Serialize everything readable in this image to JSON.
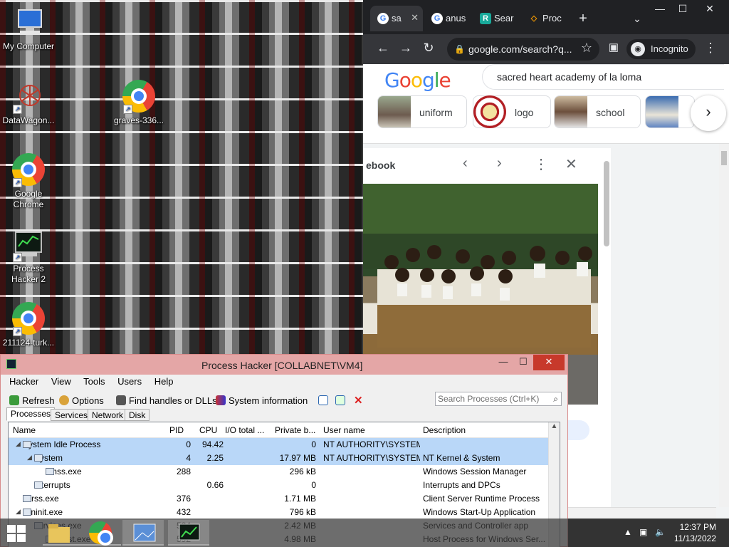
{
  "desktop": {
    "icons": [
      {
        "label_lines": [
          "My Computer"
        ],
        "icon": "computer-icon"
      },
      {
        "label_lines": [
          "DataWagon..."
        ],
        "icon": "datawagon-icon"
      },
      {
        "label_lines": [
          "graves-336..."
        ],
        "icon": "chrome-icon"
      },
      {
        "label_lines": [
          "Google",
          "Chrome"
        ],
        "icon": "chrome-icon"
      },
      {
        "label_lines": [
          "Process",
          "Hacker 2"
        ],
        "icon": "process-hacker-icon"
      },
      {
        "label_lines": [
          "211124-turk..."
        ],
        "icon": "chrome-icon"
      }
    ]
  },
  "browser": {
    "tabs": [
      {
        "label": "sa",
        "fav": "G",
        "fav_color": "#ffffff",
        "active": true
      },
      {
        "label": "anus",
        "fav": "G",
        "fav_color": "#ffffff"
      },
      {
        "label": "Sear",
        "fav": "R",
        "fav_color": "#18a99a"
      },
      {
        "label": "Proc",
        "fav": "◇",
        "fav_color": "#f29900"
      }
    ],
    "new_tab": "+",
    "tab_menu": "⌄",
    "window_controls": {
      "minimize": "—",
      "maximize": "☐",
      "close": "✕"
    },
    "url": "google.com/search?q...",
    "incognito_label": "Incognito",
    "search_query": "sacred heart academy of la loma",
    "logo": "Google",
    "chips": [
      {
        "label": "uniform"
      },
      {
        "label": "logo"
      },
      {
        "label": "school"
      }
    ],
    "panel": {
      "title": "ebook"
    }
  },
  "process_hacker": {
    "title": "Process Hacker [COLLABNET\\VM4]",
    "menu": [
      "Hacker",
      "View",
      "Tools",
      "Users",
      "Help"
    ],
    "toolbar": {
      "refresh": "Refresh",
      "options": "Options",
      "find_handles": "Find handles or DLLs",
      "system_info": "System information"
    },
    "search_placeholder": "Search Processes (Ctrl+K)",
    "tabs": [
      "Processes",
      "Services",
      "Network",
      "Disk"
    ],
    "columns": [
      "Name",
      "PID",
      "CPU",
      "I/O total ...",
      "Private b...",
      "User name",
      "Description"
    ],
    "rows": [
      {
        "name": "System Idle Process",
        "pid": "0",
        "cpu": "94.42",
        "io": "",
        "priv": "0",
        "user": "NT AUTHORITY\\SYSTEM",
        "desc": "",
        "indent": 1,
        "expand": "◢",
        "highlight": "sel"
      },
      {
        "name": "System",
        "pid": "4",
        "cpu": "2.25",
        "io": "",
        "priv": "17.97 MB",
        "user": "NT AUTHORITY\\SYSTEM",
        "desc": "NT Kernel & System",
        "indent": 2,
        "expand": "◢",
        "highlight": "sel"
      },
      {
        "name": "smss.exe",
        "pid": "288",
        "cpu": "",
        "io": "",
        "priv": "296 kB",
        "user": "",
        "desc": "Windows Session Manager",
        "indent": 3,
        "expand": "",
        "highlight": ""
      },
      {
        "name": "Interrupts",
        "pid": "",
        "cpu": "0.66",
        "io": "",
        "priv": "0",
        "user": "",
        "desc": "Interrupts and DPCs",
        "indent": 2,
        "expand": "",
        "highlight": ""
      },
      {
        "name": "csrss.exe",
        "pid": "376",
        "cpu": "",
        "io": "",
        "priv": "1.71 MB",
        "user": "",
        "desc": "Client Server Runtime Process",
        "indent": 1,
        "expand": "",
        "highlight": ""
      },
      {
        "name": "wininit.exe",
        "pid": "432",
        "cpu": "",
        "io": "",
        "priv": "796 kB",
        "user": "",
        "desc": "Windows Start-Up Application",
        "indent": 1,
        "expand": "◢",
        "highlight": ""
      },
      {
        "name": "services.exe",
        "pid": "524",
        "cpu": "",
        "io": "",
        "priv": "2.42 MB",
        "user": "",
        "desc": "Services and Controller app",
        "indent": 2,
        "expand": "",
        "highlight": ""
      },
      {
        "name": "svchost.exe",
        "pid": "592",
        "cpu": "",
        "io": "",
        "priv": "4.98 MB",
        "user": "",
        "desc": "Host Process for Windows Ser...",
        "indent": 3,
        "expand": "",
        "highlight": ""
      }
    ]
  },
  "taskbar": {
    "time": "12:37 PM",
    "date": "11/13/2022"
  }
}
